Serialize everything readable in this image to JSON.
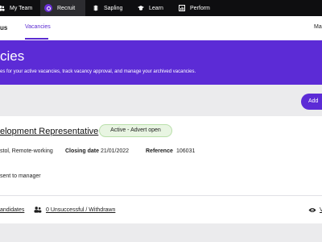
{
  "nav": {
    "items": [
      {
        "label": "My Team",
        "icon": "people-icon"
      },
      {
        "label": "Recruit",
        "icon": "recruit-icon",
        "active": true
      },
      {
        "label": "Sapling",
        "icon": "sapling-icon"
      },
      {
        "label": "Learn",
        "icon": "graduation-cap-icon"
      },
      {
        "label": "Perform",
        "icon": "chart-icon"
      }
    ]
  },
  "subnav": {
    "brand": "us",
    "tab": "Vacancies",
    "user": "Ma"
  },
  "hero": {
    "title": "cies",
    "subtitle": "es for your active vacancies, track vacancy approval, and manage your archived vacancies."
  },
  "add_button": {
    "label": "Add"
  },
  "vacancy": {
    "title": "elopment Representative",
    "status": "Active - Advert open",
    "location": "stol, Remote-working",
    "closing_date_label": "Closing date",
    "closing_date": "21/01/2022",
    "reference_label": "Reference",
    "reference": "106031",
    "note": "sent to manager",
    "candidates_link": "andidates",
    "unsuccessful_link": "0 Unsuccessful / Withdrawn",
    "view_link": "V"
  },
  "colors": {
    "brand_purple": "#5c2bd6",
    "nav_bg": "#0e0e10",
    "status_green": "#e8f5e2"
  }
}
